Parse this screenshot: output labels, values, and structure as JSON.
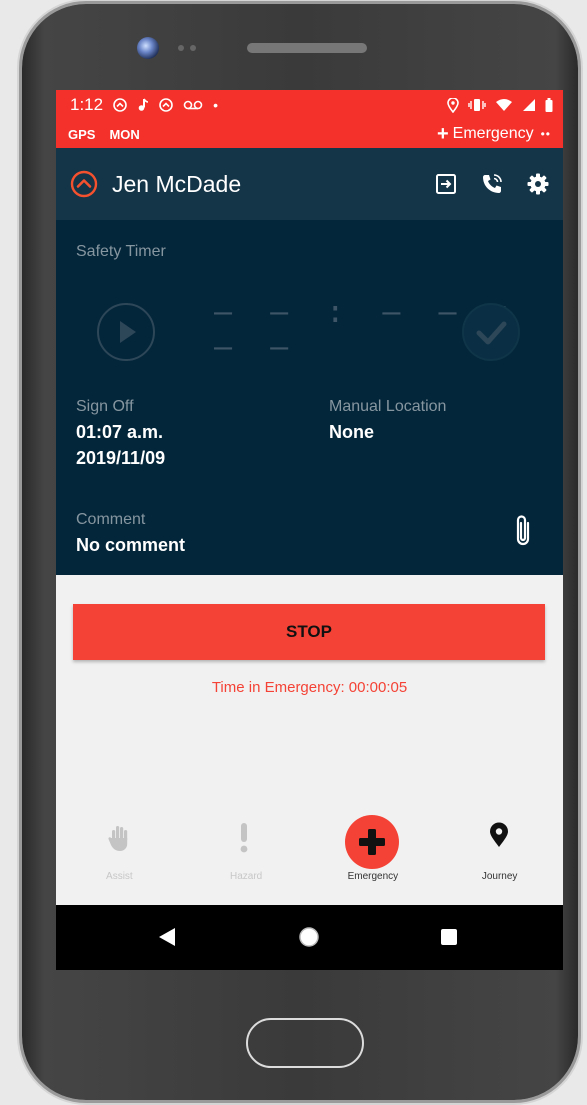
{
  "status_bar": {
    "time": "1:12",
    "left_icons": [
      "chevron-circle-icon",
      "music-note-icon",
      "chevron-circle-icon",
      "voicemail-icon",
      "dot-icon"
    ],
    "right_icons": [
      "location-icon",
      "vibrate-icon",
      "wifi-icon",
      "signal-icon",
      "battery-icon"
    ]
  },
  "alert_bar": {
    "gps": "GPS",
    "mon": "MON",
    "emergency_label": "Emergency",
    "dots": "••",
    "color": "#f4312a"
  },
  "header": {
    "name": "Jen McDade",
    "actions": [
      "logout-icon",
      "phone-call-icon",
      "gear-icon"
    ],
    "bg": "#143447"
  },
  "timer": {
    "title": "Safety Timer",
    "display": "– – : – – : – –"
  },
  "sign_off": {
    "label": "Sign Off",
    "time": "01:07 a.m.",
    "date": "2019/11/09"
  },
  "manual_location": {
    "label": "Manual Location",
    "value": "None"
  },
  "comment": {
    "label": "Comment",
    "value": "No comment"
  },
  "stop_label": "STOP",
  "emergency_time": "Time in Emergency: 00:00:05",
  "tabs": [
    {
      "label": "Assist",
      "icon": "hand-icon",
      "active": false
    },
    {
      "label": "Hazard",
      "icon": "exclamation-icon",
      "active": false
    },
    {
      "label": "Emergency",
      "icon": "plus-icon",
      "active": true
    },
    {
      "label": "Journey",
      "icon": "map-pin-icon",
      "active": false
    }
  ],
  "nav": [
    "back-icon",
    "home-icon",
    "recents-icon"
  ],
  "accent": "#f44336"
}
